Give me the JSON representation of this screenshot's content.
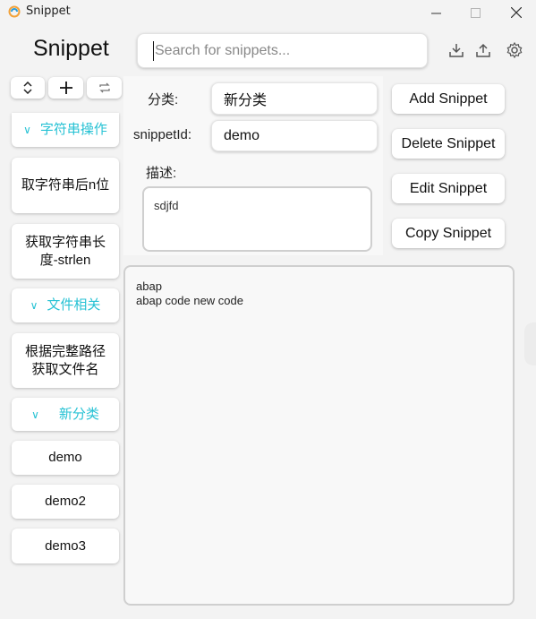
{
  "window": {
    "title": "Snippet"
  },
  "header": {
    "title": "Snippet",
    "search_placeholder": "Search for snippets..."
  },
  "sidebar": {
    "items": [
      {
        "kind": "category",
        "label": "字符串操作"
      },
      {
        "kind": "snippet",
        "label": "取字符串后n位"
      },
      {
        "kind": "snippet",
        "label": "获取字符串长度-strlen"
      },
      {
        "kind": "category",
        "label": "文件相关"
      },
      {
        "kind": "snippet",
        "label": "根据完整路径获取文件名"
      },
      {
        "kind": "category",
        "label": "新分类"
      },
      {
        "kind": "snippet",
        "label": "demo"
      },
      {
        "kind": "snippet",
        "label": "demo2"
      },
      {
        "kind": "snippet",
        "label": "demo3"
      }
    ]
  },
  "form": {
    "category_label": "分类:",
    "category_value": "新分类",
    "id_label": "snippetId:",
    "id_value": "demo",
    "desc_label": "描述:",
    "desc_value": "sdjfd"
  },
  "actions": {
    "add": "Add Snippet",
    "delete": "Delete Snippet",
    "edit": "Edit Snippet",
    "copy": "Copy Snippet"
  },
  "code": {
    "line1": "abap",
    "line2": "abap code new code"
  },
  "colors": {
    "accent": "#27c2d4",
    "background": "#f3f3f3"
  }
}
